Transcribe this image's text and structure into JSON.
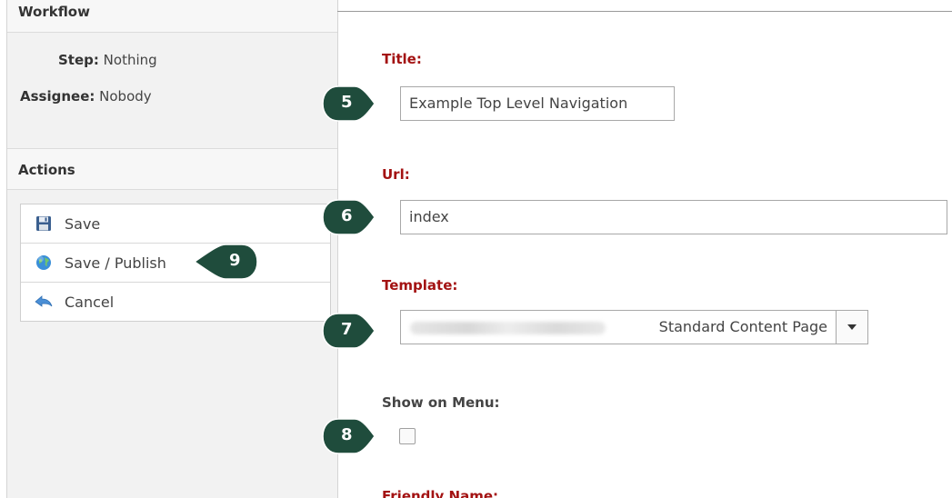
{
  "workflow": {
    "header": "Workflow",
    "step_label": "Step:",
    "step_value": "Nothing",
    "assignee_label": "Assignee:",
    "assignee_value": "Nobody"
  },
  "actions": {
    "header": "Actions",
    "items": [
      {
        "label": "Save",
        "icon": "floppy-disk-icon"
      },
      {
        "label": "Save / Publish",
        "icon": "globe-icon"
      },
      {
        "label": "Cancel",
        "icon": "back-arrow-icon"
      }
    ]
  },
  "form": {
    "title_label": "Title:",
    "title_value": "Example Top Level Navigation",
    "url_label": "Url:",
    "url_value": "index",
    "template_label": "Template:",
    "template_value": "Standard Content Page",
    "show_on_menu_label": "Show on Menu:",
    "show_on_menu_checked": false,
    "friendly_name_label": "Friendly Name:"
  },
  "callouts": {
    "title": "5",
    "url": "6",
    "template": "7",
    "show_on_menu": "8",
    "save_publish": "9"
  },
  "colors": {
    "callout_green": "#1f4c3c",
    "label_red": "#a31212"
  }
}
